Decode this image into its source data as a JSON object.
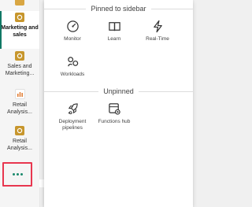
{
  "nav": {
    "items": [
      {
        "label": "",
        "icon": "report-icon"
      },
      {
        "label": "Marketing and sales",
        "icon": "report-icon",
        "active": true
      },
      {
        "label": "Sales and Marketing...",
        "icon": "report-icon"
      },
      {
        "label": "Retail Analysis...",
        "icon": "bar-chart-icon"
      },
      {
        "label": "Retail Analysis...",
        "icon": "report-icon"
      }
    ],
    "more_label": "More"
  },
  "panel": {
    "pinned_title": "Pinned to sidebar",
    "pinned": [
      {
        "label": "Monitor",
        "icon": "monitor-icon"
      },
      {
        "label": "Learn",
        "icon": "book-icon"
      },
      {
        "label": "Real-Time",
        "icon": "lightning-icon"
      },
      {
        "label": "Workloads",
        "icon": "workloads-icon"
      }
    ],
    "unpinned_title": "Unpinned",
    "unpinned": [
      {
        "label": "Deployment pipelines",
        "icon": "rocket-icon"
      },
      {
        "label": "Functions hub",
        "icon": "functions-icon"
      }
    ]
  },
  "colors": {
    "accent": "#117865",
    "report_tile": "#c7962d",
    "highlight": "#e8364f"
  }
}
